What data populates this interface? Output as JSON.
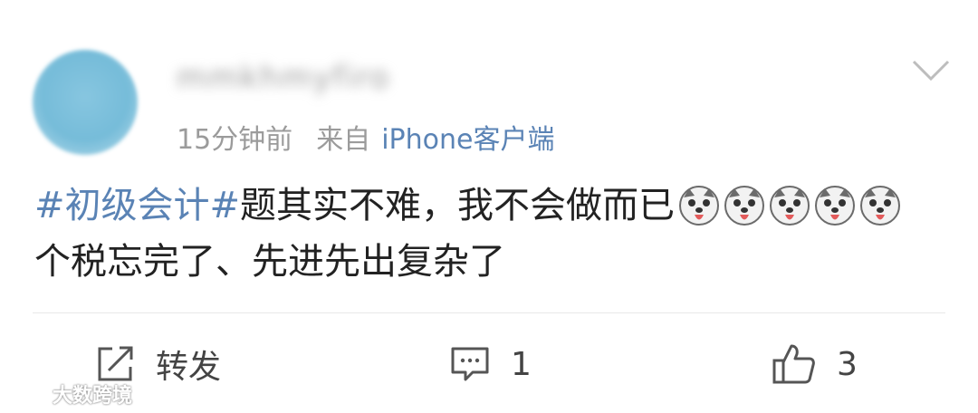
{
  "post": {
    "username": "mmkhmyfiro",
    "time": "15分钟前",
    "source_label": "来自",
    "source_device": "iPhone客户端",
    "hashtag": "#初级会计#",
    "text_line1": "题其实不难，我不会做而已",
    "emoji_count": 5,
    "emoji_name": "doge-emoji",
    "text_line2": "个税忘完了、先进先出复杂了"
  },
  "actions": {
    "repost_label": "转发",
    "comment_count": "1",
    "like_count": "3"
  },
  "watermark": {
    "text": "大数跨境"
  },
  "colors": {
    "link": "#5a83b5",
    "meta": "#9b9b9b",
    "text": "#222222",
    "avatar": "#76bcd9"
  }
}
